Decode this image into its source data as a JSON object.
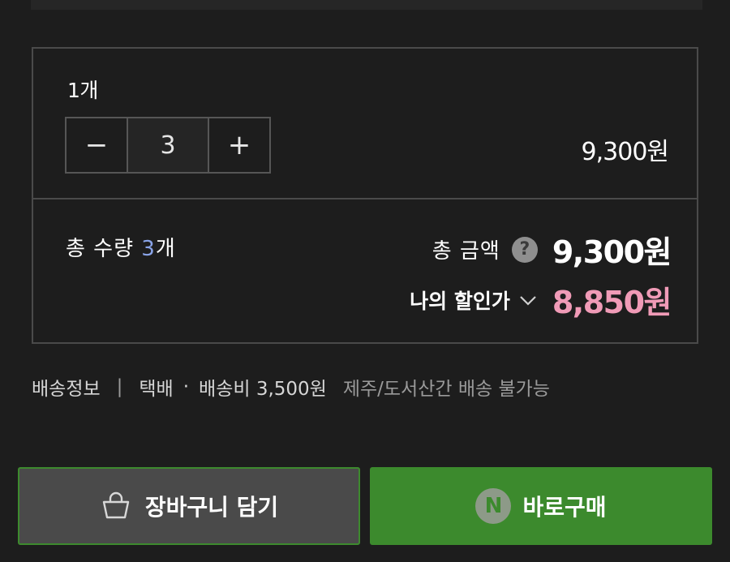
{
  "option": {
    "name": "1개",
    "decrease_symbol": "−",
    "quantity": "3",
    "increase_symbol": "+",
    "price": "9,300원"
  },
  "summary": {
    "total_qty_label": "총 수량",
    "total_qty_value": "3",
    "total_qty_unit": "개",
    "total_amount_label": "총 금액",
    "help_symbol": "?",
    "total_amount_value": "9,300원",
    "discount_label": "나의 할인가",
    "discount_value": "8,850원"
  },
  "shipping": {
    "title": "배송정보",
    "separator": "|",
    "method": "택배",
    "dot": "·",
    "fee": "배송비 3,500원",
    "note": "제주/도서산간 배송 불가능"
  },
  "actions": {
    "cart_label": "장바구니 담기",
    "npay_letter": "N",
    "buy_label": "바로구매"
  },
  "colors": {
    "background": "#1d1d1d",
    "border": "#4a4a4a",
    "qty_accent": "#8aa4e8",
    "discount_accent": "#f09bb7",
    "buy_green": "#3c8a2d",
    "cart_gray": "#4a4a4a"
  },
  "icons": {
    "help": "question-circle-icon",
    "chevron": "chevron-down-icon",
    "cart": "shopping-bag-icon",
    "npay": "naver-pay-icon"
  }
}
